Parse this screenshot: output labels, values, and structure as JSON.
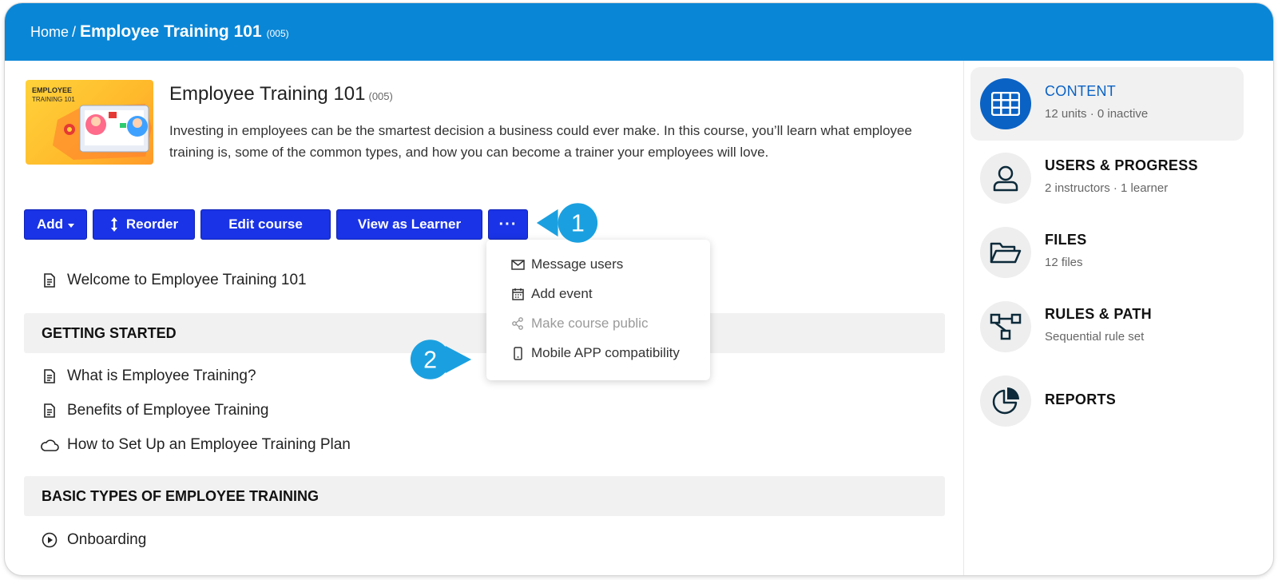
{
  "breadcrumb": {
    "home": "Home",
    "separator": "/",
    "title": "Employee Training 101",
    "code": "(005)"
  },
  "course": {
    "title": "Employee Training 101",
    "code": "(005)",
    "description": "Investing in employees can be the smartest decision a business could ever make. In this course, you’ll learn what employee training is, some of the common types, and how you can become a trainer your employees will love.",
    "thumbnail": {
      "title": "EMPLOYEE",
      "subtitle": "TRAINING 101"
    }
  },
  "toolbar": {
    "add_label": "Add",
    "reorder_label": "Reorder",
    "edit_label": "Edit course",
    "view_label": "View as Learner",
    "more_label": "···"
  },
  "dropdown": {
    "items": [
      {
        "label": "Message users",
        "icon": "envelope-icon"
      },
      {
        "label": "Add event",
        "icon": "calendar-icon"
      },
      {
        "label": "Make course public",
        "icon": "share-icon",
        "disabled": true
      },
      {
        "label": "Mobile APP compatibility",
        "icon": "mobile-icon"
      }
    ]
  },
  "callouts": [
    "1",
    "2"
  ],
  "units": {
    "welcome": {
      "label": "Welcome to Employee Training 101",
      "icon": "document-icon"
    },
    "section1": "GETTING STARTED",
    "s1_items": [
      {
        "label": "What is Employee Training?",
        "icon": "document-icon"
      },
      {
        "label": "Benefits of Employee Training",
        "icon": "document-icon"
      },
      {
        "label": "How to Set Up an Employee Training Plan",
        "icon": "cloud-icon"
      }
    ],
    "section2": "BASIC TYPES OF EMPLOYEE TRAINING",
    "s2_items": [
      {
        "label": "Onboarding",
        "icon": "play-circle-icon"
      }
    ]
  },
  "sidebar": {
    "items": [
      {
        "title": "CONTENT",
        "sub": "12 units · 0 inactive",
        "icon": "grid-icon",
        "active": true
      },
      {
        "title": "USERS & PROGRESS",
        "sub": "2 instructors · 1 learner",
        "icon": "user-icon"
      },
      {
        "title": "FILES",
        "sub": "12 files",
        "icon": "folder-icon"
      },
      {
        "title": "RULES & PATH",
        "sub": "Sequential rule set",
        "icon": "flow-icon"
      },
      {
        "title": "REPORTS",
        "sub": "",
        "icon": "pie-chart-icon"
      }
    ]
  },
  "colors": {
    "header": "#0a86d6",
    "button": "#1a33e6",
    "callout": "#1aa0e0",
    "active_nav": "#0a62c4"
  }
}
